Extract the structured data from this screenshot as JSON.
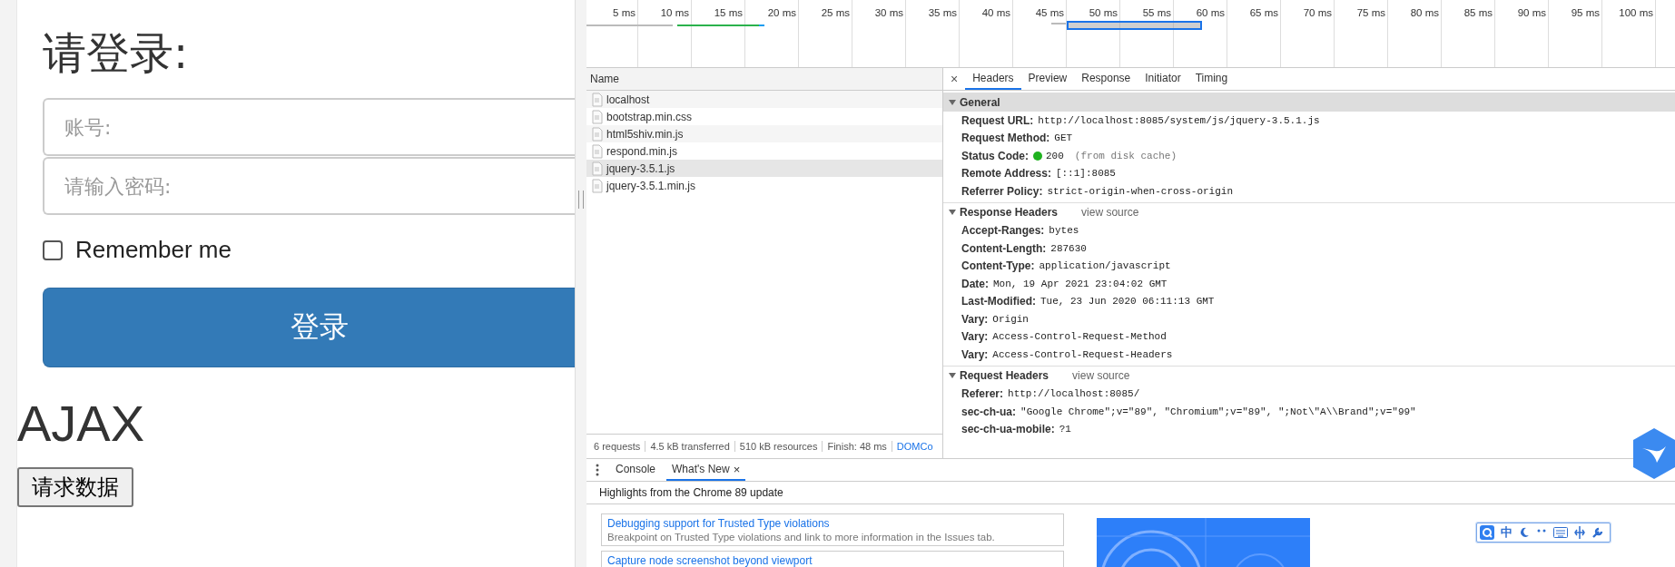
{
  "page": {
    "heading": "请登录:",
    "fields": [
      {
        "placeholder": "账号:"
      },
      {
        "placeholder": "请输入密码:"
      }
    ],
    "remember": {
      "label": "Remember me",
      "checked": false
    },
    "login_button": "登录",
    "ajax_heading": "AJAX",
    "request_button": "请求数据"
  },
  "devtools": {
    "timeline": {
      "ticks": [
        "5 ms",
        "10 ms",
        "15 ms",
        "20 ms",
        "25 ms",
        "30 ms",
        "35 ms",
        "40 ms",
        "45 ms",
        "50 ms",
        "55 ms",
        "60 ms",
        "65 ms",
        "70 ms",
        "75 ms",
        "80 ms",
        "85 ms",
        "90 ms",
        "95 ms",
        "100 ms"
      ]
    },
    "requests": {
      "column": "Name",
      "rows": [
        {
          "name": "localhost",
          "selected": false
        },
        {
          "name": "bootstrap.min.css",
          "selected": false
        },
        {
          "name": "html5shiv.min.js",
          "selected": false
        },
        {
          "name": "respond.min.js",
          "selected": false
        },
        {
          "name": "jquery-3.5.1.js",
          "selected": true
        },
        {
          "name": "jquery-3.5.1.min.js",
          "selected": false
        }
      ]
    },
    "summary": [
      {
        "kind": "text",
        "text": "6 requests"
      },
      {
        "kind": "text",
        "text": "4.5 kB transferred"
      },
      {
        "kind": "text",
        "text": "510 kB resources"
      },
      {
        "kind": "text",
        "text": "Finish: 48 ms"
      },
      {
        "kind": "link",
        "text": "DOMCo"
      }
    ],
    "detail_close": "×",
    "detail_tabs": [
      {
        "label": "Headers",
        "selected": true
      },
      {
        "label": "Preview",
        "selected": false
      },
      {
        "label": "Response",
        "selected": false
      },
      {
        "label": "Initiator",
        "selected": false
      },
      {
        "label": "Timing",
        "selected": false
      }
    ],
    "sections": [
      {
        "title": "General",
        "expanded": true,
        "rows": [
          {
            "key": "Request URL:",
            "value": "http://localhost:8085/system/js/jquery-3.5.1.js"
          },
          {
            "key": "Request Method:",
            "value": "GET"
          },
          {
            "key": "Status Code:",
            "value": "200",
            "note": "(from disk cache)",
            "color": "#1fb21f"
          },
          {
            "key": "Remote Address:",
            "value": "[::1]:8085"
          },
          {
            "key": "Referrer Policy:",
            "value": "strict-origin-when-cross-origin"
          }
        ]
      },
      {
        "title": "Response Headers",
        "expanded": true,
        "view_source": "view source",
        "rows": [
          {
            "key": "Accept-Ranges:",
            "value": "bytes"
          },
          {
            "key": "Content-Length:",
            "value": "287630"
          },
          {
            "key": "Content-Type:",
            "value": "application/javascript"
          },
          {
            "key": "Date:",
            "value": "Mon, 19 Apr 2021 23:04:02 GMT"
          },
          {
            "key": "Last-Modified:",
            "value": "Tue, 23 Jun 2020 06:11:13 GMT"
          },
          {
            "key": "Vary:",
            "value": "Origin"
          },
          {
            "key": "Vary:",
            "value": "Access-Control-Request-Method"
          },
          {
            "key": "Vary:",
            "value": "Access-Control-Request-Headers"
          }
        ]
      },
      {
        "title": "Request Headers",
        "expanded": true,
        "view_source": "view source",
        "rows": [
          {
            "key": "Referer:",
            "value": "http://localhost:8085/"
          },
          {
            "key": "sec-ch-ua:",
            "value": "\"Google Chrome\";v=\"89\", \"Chromium\";v=\"89\", \";Not\\\"A\\\\Brand\";v=\"99\""
          },
          {
            "key": "sec-ch-ua-mobile:",
            "value": "?1"
          }
        ]
      }
    ],
    "drawer": {
      "tabs": [
        {
          "label": "Console",
          "selected": false
        },
        {
          "label": "What's New",
          "selected": true,
          "close": "×"
        }
      ],
      "banner": "Highlights from the Chrome 89 update",
      "cards": [
        {
          "title": "Debugging support for Trusted Type violations",
          "description": "Breakpoint on Trusted Type violations and link to more information in the Issues tab."
        },
        {
          "title": "Capture node screenshot beyond viewport"
        }
      ]
    }
  },
  "ime_toolbar": {
    "label": "中"
  }
}
